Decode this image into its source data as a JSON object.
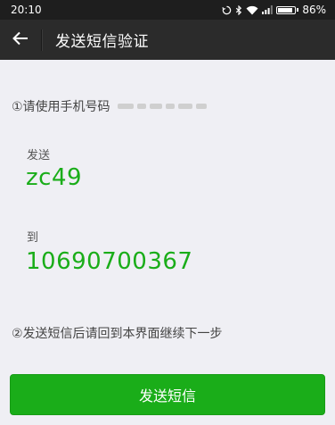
{
  "status_bar": {
    "time": "20:10",
    "battery_percent": "86%",
    "icons": [
      "sync-icon",
      "bluetooth-icon",
      "wifi-icon",
      "signal-icon",
      "battery-icon"
    ]
  },
  "header": {
    "title": "发送短信验证",
    "back_icon": "arrow-left-icon"
  },
  "main": {
    "step1_text": "①请使用手机号码",
    "send_label": "发送",
    "sms_content": "zc49",
    "to_label": "到",
    "recipient_number": "10690700367",
    "step2_text": "②发送短信后请回到本界面继续下一步",
    "send_button_label": "发送短信"
  },
  "colors": {
    "accent": "#1aad19",
    "header_bg": "#2b2b2b",
    "page_bg": "#efeff4"
  }
}
